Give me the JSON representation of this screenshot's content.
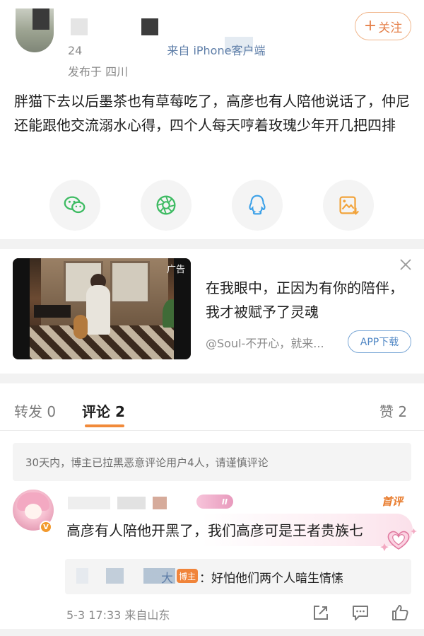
{
  "header": {
    "meta_prefix": "24",
    "meta_from": "来自 iPhone客户端",
    "location": "发布于 四川",
    "follow_label": "关注"
  },
  "post": {
    "text": "胖猫下去以后墨茶也有草莓吃了，高彦也有人陪他说话了，仲尼还能跟他交流溺水心得，四个人每天哼着玫瑰少年开几把四排"
  },
  "share": {
    "icons": [
      "wechat-icon",
      "moments-icon",
      "qq-icon",
      "save-image-icon"
    ]
  },
  "ad": {
    "tag": "广告",
    "title": "在我眼中，正因为有你的陪伴，我才被赋予了灵魂",
    "source": "@Soul-不开心，就来...",
    "download_label": "APP下载"
  },
  "tabs": {
    "repost": "转发 0",
    "comments": "评论 2",
    "likes": "赞 2"
  },
  "notice": "30天内，博主已拉黑恶意评论用户4人，请谨慎评论",
  "comment": {
    "level_badge": "II",
    "first_label": "首评",
    "text": "高彦有人陪他开黑了，我们高彦可是王者贵族七",
    "reply": {
      "name_tail": "大",
      "owner_badge": "博主",
      "text": "：好怕他们两个人暗生情愫"
    },
    "time": "5-3 17:33",
    "location": "来自山东"
  },
  "colors": {
    "accent_orange": "#f18a3a",
    "link_blue": "#5e7ea8",
    "wechat_green": "#3dbb62",
    "qq_blue": "#3aa0e8",
    "save_orange": "#f2a33a"
  }
}
